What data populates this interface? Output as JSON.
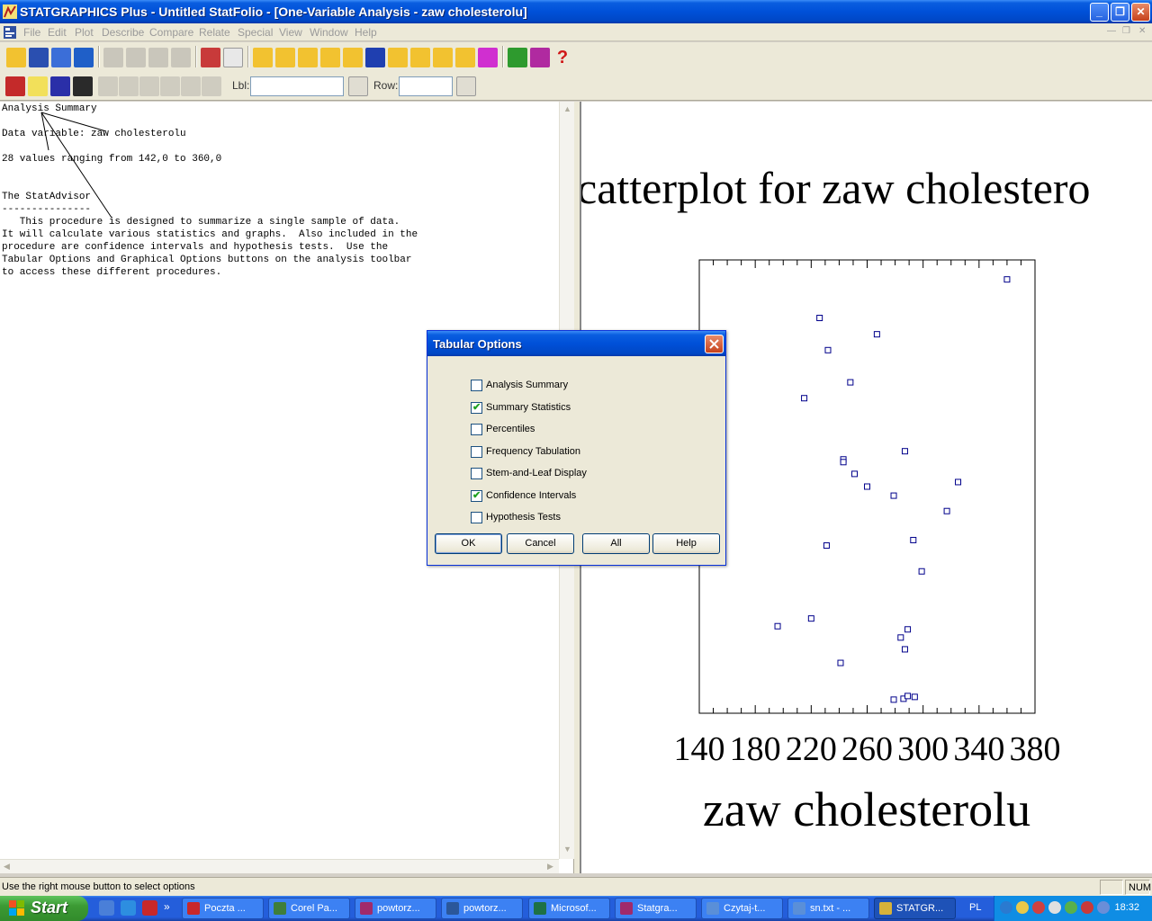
{
  "window": {
    "title": "STATGRAPHICS Plus - Untitled StatFolio - [One-Variable Analysis - zaw cholesterolu]",
    "minimize_label": "_",
    "maximize_label": "❐",
    "close_label": "✕"
  },
  "menu": {
    "items": [
      "File",
      "Edit",
      "Plot",
      "Describe",
      "Compare",
      "Relate",
      "Special",
      "View",
      "Window",
      "Help"
    ]
  },
  "toolbar2": {
    "lbl_label": "Lbl:",
    "lbl_value": "",
    "row_label": "Row:",
    "row_value": ""
  },
  "left_pane": {
    "text": "Analysis Summary\n\nData variable: zaw cholesterolu\n\n28 values ranging from 142,0 to 360,0\n\n\nThe StatAdvisor\n---------------\n   This procedure is designed to summarize a single sample of data.\nIt will calculate various statistics and graphs.  Also included in the\nprocedure are confidence intervals and hypothesis tests.  Use the\nTabular Options and Graphical Options buttons on the analysis toolbar\nto access these different procedures."
  },
  "chart_data": {
    "type": "scatter",
    "title": "catterplot for zaw cholestero",
    "xlabel": "zaw cholesterolu",
    "ylabel": "",
    "xlim": [
      140,
      380
    ],
    "x_ticks": [
      "140",
      "180",
      "220",
      "260",
      "300",
      "340",
      "380"
    ],
    "grid": false,
    "points": [
      {
        "x": 360,
        "y": 0.957
      },
      {
        "x": 226,
        "y": 0.872
      },
      {
        "x": 267,
        "y": 0.836
      },
      {
        "x": 232,
        "y": 0.801
      },
      {
        "x": 248,
        "y": 0.73
      },
      {
        "x": 215,
        "y": 0.695
      },
      {
        "x": 287,
        "y": 0.578
      },
      {
        "x": 243,
        "y": 0.56
      },
      {
        "x": 243,
        "y": 0.554
      },
      {
        "x": 251,
        "y": 0.528
      },
      {
        "x": 325,
        "y": 0.51
      },
      {
        "x": 279,
        "y": 0.48
      },
      {
        "x": 317,
        "y": 0.446
      },
      {
        "x": 142,
        "y": 0.358
      },
      {
        "x": 231,
        "y": 0.37
      },
      {
        "x": 293,
        "y": 0.382
      },
      {
        "x": 299,
        "y": 0.313
      },
      {
        "x": 196,
        "y": 0.192
      },
      {
        "x": 220,
        "y": 0.209
      },
      {
        "x": 289,
        "y": 0.185
      },
      {
        "x": 284,
        "y": 0.167
      },
      {
        "x": 287,
        "y": 0.141
      },
      {
        "x": 241,
        "y": 0.111
      },
      {
        "x": 279,
        "y": 0.03
      },
      {
        "x": 286,
        "y": 0.032
      },
      {
        "x": 289,
        "y": 0.038
      },
      {
        "x": 294,
        "y": 0.036
      },
      {
        "x": 260,
        "y": 0.5
      }
    ]
  },
  "dialog": {
    "title": "Tabular Options",
    "options": [
      {
        "label": "Analysis Summary",
        "checked": false
      },
      {
        "label": "Summary Statistics",
        "checked": true
      },
      {
        "label": "Percentiles",
        "checked": false
      },
      {
        "label": "Frequency Tabulation",
        "checked": false
      },
      {
        "label": "Stem-and-Leaf Display",
        "checked": false
      },
      {
        "label": "Confidence Intervals",
        "checked": true
      },
      {
        "label": "Hypothesis Tests",
        "checked": false
      }
    ],
    "buttons": {
      "ok": "OK",
      "cancel": "Cancel",
      "all": "All",
      "help": "Help"
    }
  },
  "statusbar": {
    "text": "Use the right mouse button to select options",
    "num": "NUM"
  },
  "taskbar": {
    "start_label": "Start",
    "overflow_label": "»",
    "tasks": [
      {
        "label": "Poczta ...",
        "icon_color": "#c8282a",
        "icon": "opera-icon"
      },
      {
        "label": "Corel Pa...",
        "icon_color": "#3f7e3a",
        "icon": "corel-icon"
      },
      {
        "label": "powtorz...",
        "icon_color": "#a02a6b",
        "icon": "winrar-icon"
      },
      {
        "label": "powtorz...",
        "icon_color": "#2b579a",
        "icon": "word-icon"
      },
      {
        "label": "Microsof...",
        "icon_color": "#1e7145",
        "icon": "excel-icon"
      },
      {
        "label": "Statgra...",
        "icon_color": "#a02a6b",
        "icon": "winrar-icon"
      },
      {
        "label": "Czytaj-t...",
        "icon_color": "#5a8fd8",
        "icon": "notepad-icon"
      },
      {
        "label": "sn.txt - ...",
        "icon_color": "#5a8fd8",
        "icon": "notepad-icon"
      },
      {
        "label": "STATGR...",
        "icon_color": "#d6b23a",
        "icon": "statgraphics-icon"
      }
    ],
    "language": "PL",
    "clock": "18:32"
  }
}
